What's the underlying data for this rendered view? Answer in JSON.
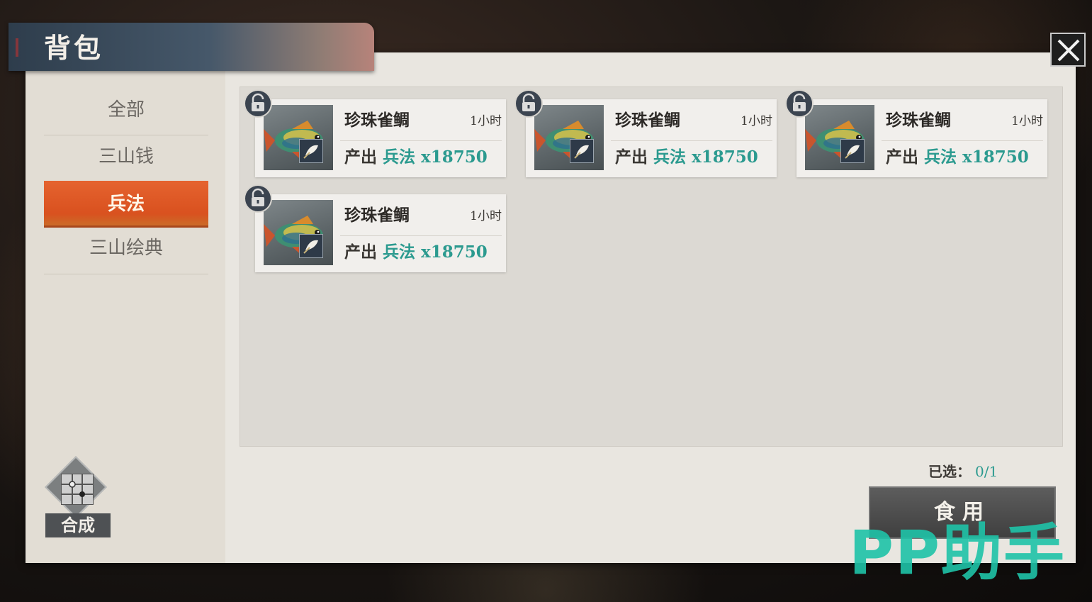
{
  "window": {
    "title": "背包"
  },
  "colors": {
    "accent": "#e5632f",
    "value_teal": "#2b9a8f",
    "watermark": "#1fc3a8"
  },
  "sidebar": {
    "tabs": [
      {
        "label": "全部",
        "active": false
      },
      {
        "label": "三山钱",
        "active": false
      },
      {
        "label": "兵法",
        "active": true
      },
      {
        "label": "三山绘典",
        "active": false
      }
    ]
  },
  "items": [
    {
      "name": "珍珠雀鲷",
      "duration": "1小时",
      "output_label": "产出",
      "output_value": "兵法 x18750",
      "icon": "fish-icon",
      "sub_icon": "scroll-icon",
      "locked": true
    },
    {
      "name": "珍珠雀鲷",
      "duration": "1小时",
      "output_label": "产出",
      "output_value": "兵法 x18750",
      "icon": "fish-icon",
      "sub_icon": "scroll-icon",
      "locked": true
    },
    {
      "name": "珍珠雀鲷",
      "duration": "1小时",
      "output_label": "产出",
      "output_value": "兵法 x18750",
      "icon": "fish-icon",
      "sub_icon": "scroll-icon",
      "locked": true
    },
    {
      "name": "珍珠雀鲷",
      "duration": "1小时",
      "output_label": "产出",
      "output_value": "兵法 x18750",
      "icon": "fish-icon",
      "sub_icon": "scroll-icon",
      "locked": true
    }
  ],
  "footer": {
    "selected_label": "已选：",
    "selected_value": "0/1",
    "use_button": "食用",
    "craft_label": "合成"
  },
  "watermark": "PP助手"
}
